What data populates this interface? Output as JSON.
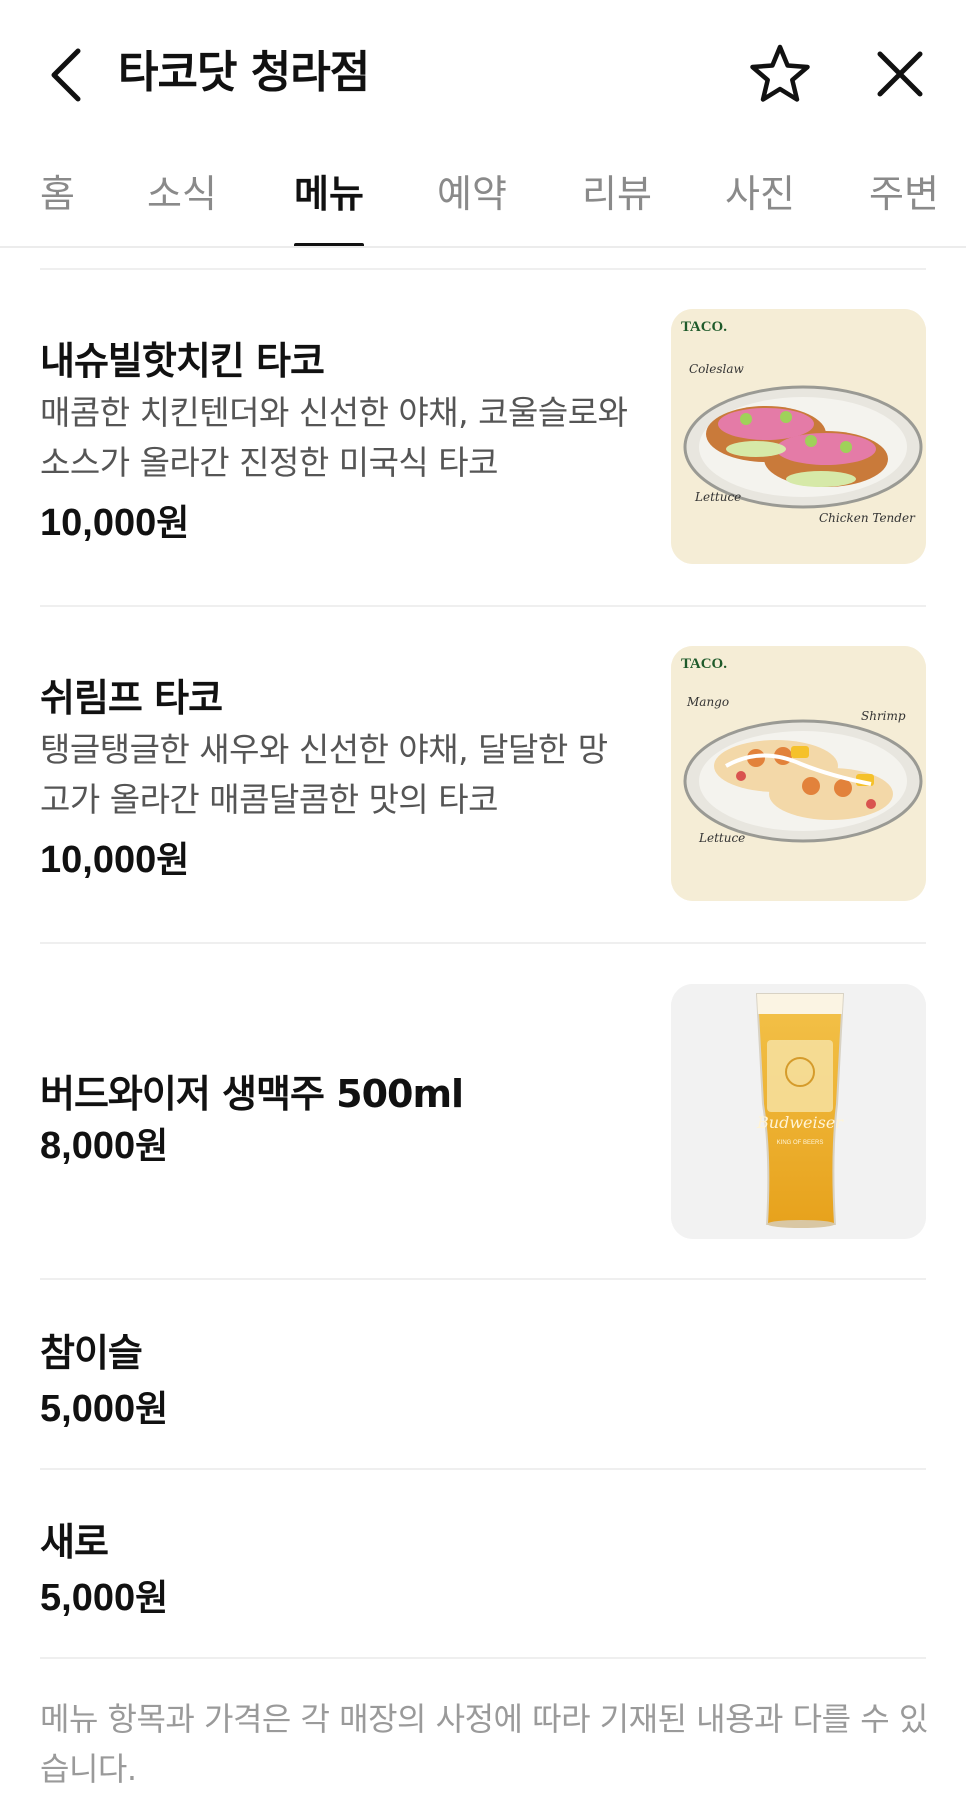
{
  "header": {
    "title": "타코닷 청라점",
    "back_icon": "chevron-left-icon",
    "favorite_icon": "star-outline-icon",
    "close_icon": "close-icon"
  },
  "tabs": [
    {
      "label": "홈",
      "active": false
    },
    {
      "label": "소식",
      "active": false
    },
    {
      "label": "메뉴",
      "active": true
    },
    {
      "label": "예약",
      "active": false
    },
    {
      "label": "리뷰",
      "active": false
    },
    {
      "label": "사진",
      "active": false
    },
    {
      "label": "주변",
      "active": false
    }
  ],
  "menu": {
    "items": [
      {
        "name": "내슈빌핫치킨 타코",
        "description": "매콤한 치킨텐더와 신선한 야채, 코울슬로와 소스가 올라간 진정한 미국식 타코",
        "price_number": "10,000",
        "price_unit": "원",
        "image": {
          "brand": "TACO.",
          "labels": [
            "Coleslaw",
            "Lettuce",
            "Chicken Tender"
          ]
        }
      },
      {
        "name": "쉬림프 타코",
        "description": "탱글탱글한 새우와 신선한 야채, 달달한 망고가 올라간 매콤달콤한 맛의 타코",
        "price_number": "10,000",
        "price_unit": "원",
        "image": {
          "brand": "TACO.",
          "labels": [
            "Mango",
            "Shrimp",
            "Lettuce"
          ]
        }
      },
      {
        "name": "버드와이저 생맥주 500ml",
        "price_number": "8,000",
        "price_unit": "원",
        "image": {
          "glass_text": "Budweiser",
          "glass_subtext": "KING OF BEERS"
        }
      },
      {
        "name": "참이슬",
        "price_number": "5,000",
        "price_unit": "원"
      },
      {
        "name": "새로",
        "price_number": "5,000",
        "price_unit": "원"
      }
    ],
    "notice": "메뉴 항목과 가격은 각 매장의 사정에 따라 기재된 내용과 다를 수 있습니다."
  },
  "colors": {
    "text_primary": "#111111",
    "text_secondary": "#555555",
    "tab_inactive": "#8a8a8a",
    "notice": "#9a9a9a",
    "thumb_background": "#f5edd6"
  }
}
